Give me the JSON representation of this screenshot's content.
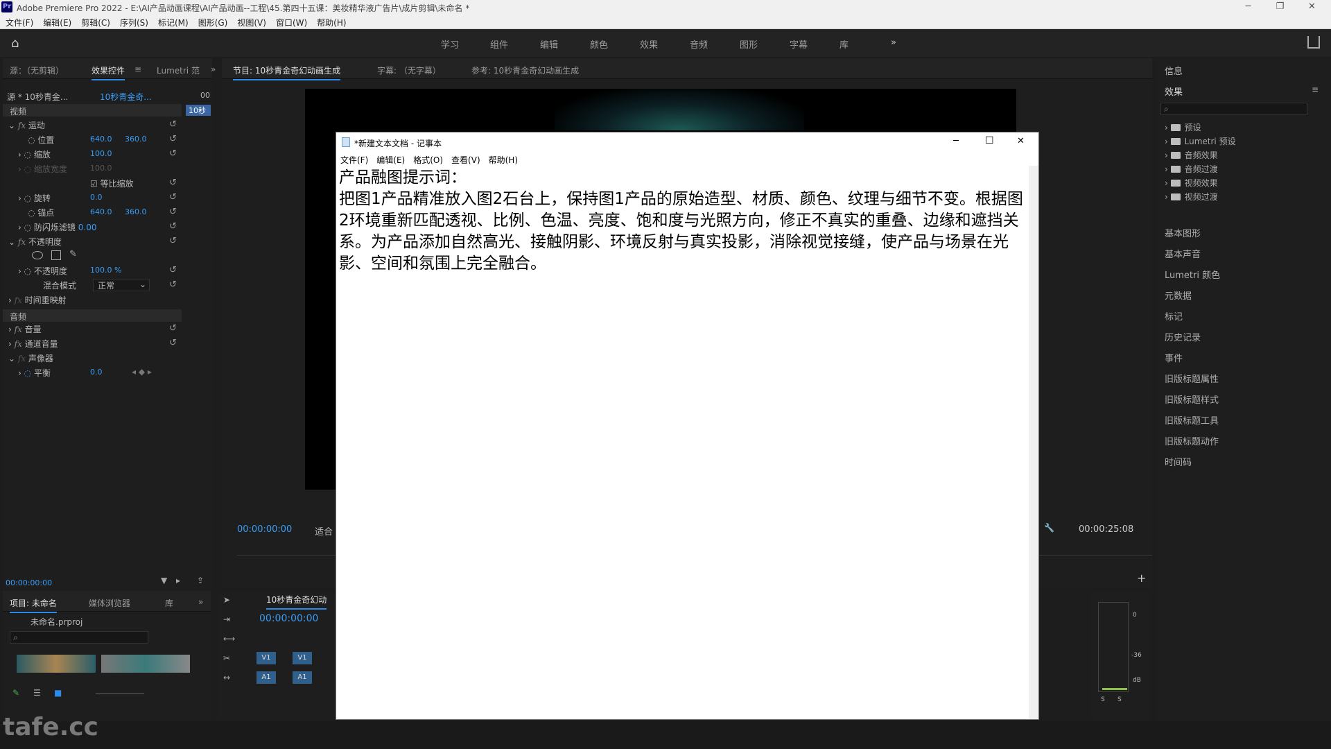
{
  "window": {
    "logo": "Pr",
    "title": "Adobe Premiere Pro 2022 - E:\\AI产品动画课程\\AI产品动画--工程\\45.第四十五课：美妆精华液广告片\\成片剪辑\\未命名 *",
    "minimize": "─",
    "maximize": "❐",
    "close": "✕"
  },
  "menu": [
    "文件(F)",
    "编辑(E)",
    "剪辑(C)",
    "序列(S)",
    "标记(M)",
    "图形(G)",
    "视图(V)",
    "窗口(W)",
    "帮助(H)"
  ],
  "workspaces": [
    "学习",
    "组件",
    "编辑",
    "颜色",
    "效果",
    "音频",
    "图形",
    "字幕",
    "库",
    "»"
  ],
  "effect_controls": {
    "tabs": [
      "源：（无剪辑）",
      "效果控件",
      "Lumetri 范",
      "»"
    ],
    "source": "源 * 10秒青金...",
    "sequence": "10秒青金奇...",
    "time_head": "00",
    "time_chip": "10秒",
    "video_label": "视频",
    "motion": "运动",
    "position_label": "位置",
    "position_x": "640.0",
    "position_y": "360.0",
    "scale_label": "缩放",
    "scale_val": "100.0",
    "scale_width_label": "缩放宽度",
    "scale_width_val": "100.0",
    "uniform_scale": "等比缩放",
    "rotation_label": "旋转",
    "rotation_val": "0.0",
    "anchor_label": "锚点",
    "anchor_x": "640.0",
    "anchor_y": "360.0",
    "flicker_label": "防闪烁滤镜",
    "flicker_val": "0.00",
    "opacity_group": "不透明度",
    "opacity_label": "不透明度",
    "opacity_val": "100.0 %",
    "blend_label": "混合模式",
    "blend_val": "正常",
    "time_remap": "时间重映射",
    "audio_label": "音频",
    "volume": "音量",
    "channel_volume": "通道音量",
    "panner": "声像器",
    "balance_label": "平衡",
    "balance_val": "0.0",
    "timecode": "00:00:00:00"
  },
  "program": {
    "tabs": [
      "节目: 10秒青金奇幻动画生成",
      "字幕: （无字幕）",
      "参考: 10秒青金奇幻动画生成"
    ],
    "timecode": "00:00:00:00",
    "fit": "适合",
    "duration": "00:00:25:08"
  },
  "project": {
    "tabs": [
      "项目: 未命名",
      "媒体浏览器",
      "库",
      "»"
    ],
    "file": "未命名.prproj"
  },
  "timeline": {
    "tab": "10秒青金奇幻动",
    "timecode": "00:00:00:00",
    "v1": "V1",
    "a1": "A1"
  },
  "notepad": {
    "title": "*新建文本文档 - 记事本",
    "menu": [
      "文件(F)",
      "编辑(E)",
      "格式(O)",
      "查看(V)",
      "帮助(H)"
    ],
    "minimize": "─",
    "maximize": "☐",
    "close": "✕",
    "text": "产品融图提示词：\n把图1产品精准放入图2石台上，保持图1产品的原始造型、材质、颜色、纹理与细节不变。根据图2环境重新匹配透视、比例、色温、亮度、饱和度与光照方向，修正不真实的重叠、边缘和遮挡关系。为产品添加自然高光、接触阴影、环境反射与真实投影，消除视觉接缝，使产品与场景在光影、空间和氛围上完全融合。"
  },
  "right_panel": {
    "info": "信息",
    "effects": "效果",
    "tree": [
      "预设",
      "Lumetri 预设",
      "音频效果",
      "音频过渡",
      "视频效果",
      "视频过渡"
    ],
    "panels": [
      "基本图形",
      "基本声音",
      "Lumetri 颜色",
      "元数据",
      "标记",
      "历史记录",
      "事件",
      "旧版标题属性",
      "旧版标题样式",
      "旧版标题工具",
      "旧版标题动作",
      "时间码"
    ]
  },
  "audio_meter": {
    "db0": "0",
    "db36": "-36",
    "db": "dB",
    "s": "S"
  },
  "watermark": "tafe.cc"
}
